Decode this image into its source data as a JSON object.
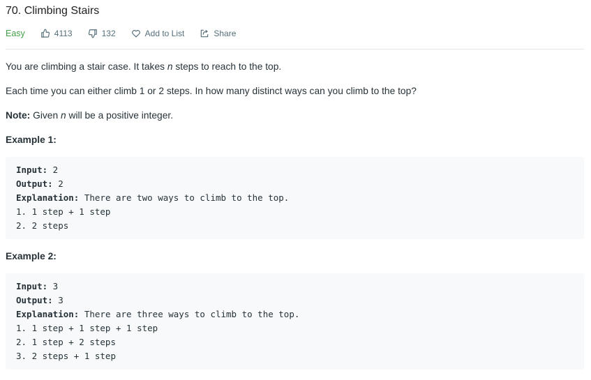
{
  "problem": {
    "title": "70. Climbing Stairs",
    "difficulty": "Easy",
    "likes": "4113",
    "dislikes": "132",
    "add_to_list": "Add to List",
    "share": "Share"
  },
  "description": {
    "p1_pre": "You are climbing a stair case. It takes ",
    "p1_var": "n",
    "p1_post": " steps to reach to the top.",
    "p2": "Each time you can either climb 1 or 2 steps. In how many distinct ways can you climb to the top?",
    "note_label": "Note:",
    "note_pre": " Given ",
    "note_var": "n",
    "note_post": " will be a positive integer."
  },
  "examples": [
    {
      "title": "Example 1:",
      "input_label": "Input:",
      "input_value": " 2",
      "output_label": "Output:",
      "output_value": " 2",
      "explanation_label": "Explanation:",
      "explanation_value": " There are two ways to climb to the top.",
      "steps": [
        "1. 1 step + 1 step",
        "2. 2 steps"
      ]
    },
    {
      "title": "Example 2:",
      "input_label": "Input:",
      "input_value": " 3",
      "output_label": "Output:",
      "output_value": " 3",
      "explanation_label": "Explanation:",
      "explanation_value": " There are three ways to climb to the top.",
      "steps": [
        "1. 1 step + 1 step + 1 step",
        "2. 1 step + 2 steps",
        "3. 2 steps + 1 step"
      ]
    }
  ],
  "icons": {
    "like": "thumbs-up-icon",
    "dislike": "thumbs-down-icon",
    "add_to_list": "heart-icon",
    "share": "share-icon"
  },
  "colors": {
    "difficulty_easy": "#43a047",
    "meta_text": "#546e7a",
    "code_bg": "#f7f9fa"
  }
}
